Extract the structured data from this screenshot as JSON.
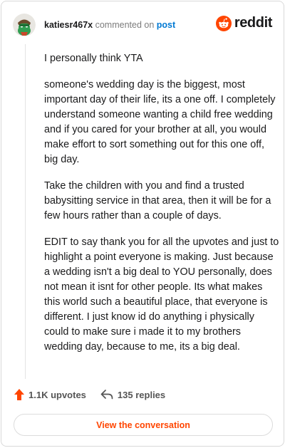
{
  "header": {
    "username": "katiesr467x",
    "commented_on": "commented on",
    "post_link": "post",
    "logo_text": "reddit",
    "logo_icon": "reddit-snoo-icon",
    "avatar_icon": "snoo-avatar-icon"
  },
  "comment": {
    "paragraphs": [
      "I personally think YTA",
      "someone's wedding day is the biggest, most important day of their life, its a one off. I completely understand someone wanting a child free wedding and if you cared for your brother at all, you would make effort to sort something out for this one off, big day.",
      "Take the children with you and find a trusted babysitting service in that area, then it will be for a few hours rather than a couple of days.",
      "EDIT to say thank you for all the upvotes and just to highlight a point everyone is making. Just because a wedding isn't a big deal to YOU personally, does not mean it isnt for other people. Its what makes this world such a beautiful place, that everyone is different. I just know id do anything i physically could to make sure i made it to my brothers wedding day, because to me, its a big deal."
    ]
  },
  "footer": {
    "upvotes": "1.1K upvotes",
    "replies": "135 replies",
    "upvote_icon": "upvote-arrow-icon",
    "reply_icon": "reply-arrow-icon"
  },
  "view_button": {
    "label": "View the conversation"
  },
  "colors": {
    "brand": "#ff4500",
    "link": "#0079d3",
    "text": "#1a1a1b",
    "muted": "#7c7c7c"
  }
}
